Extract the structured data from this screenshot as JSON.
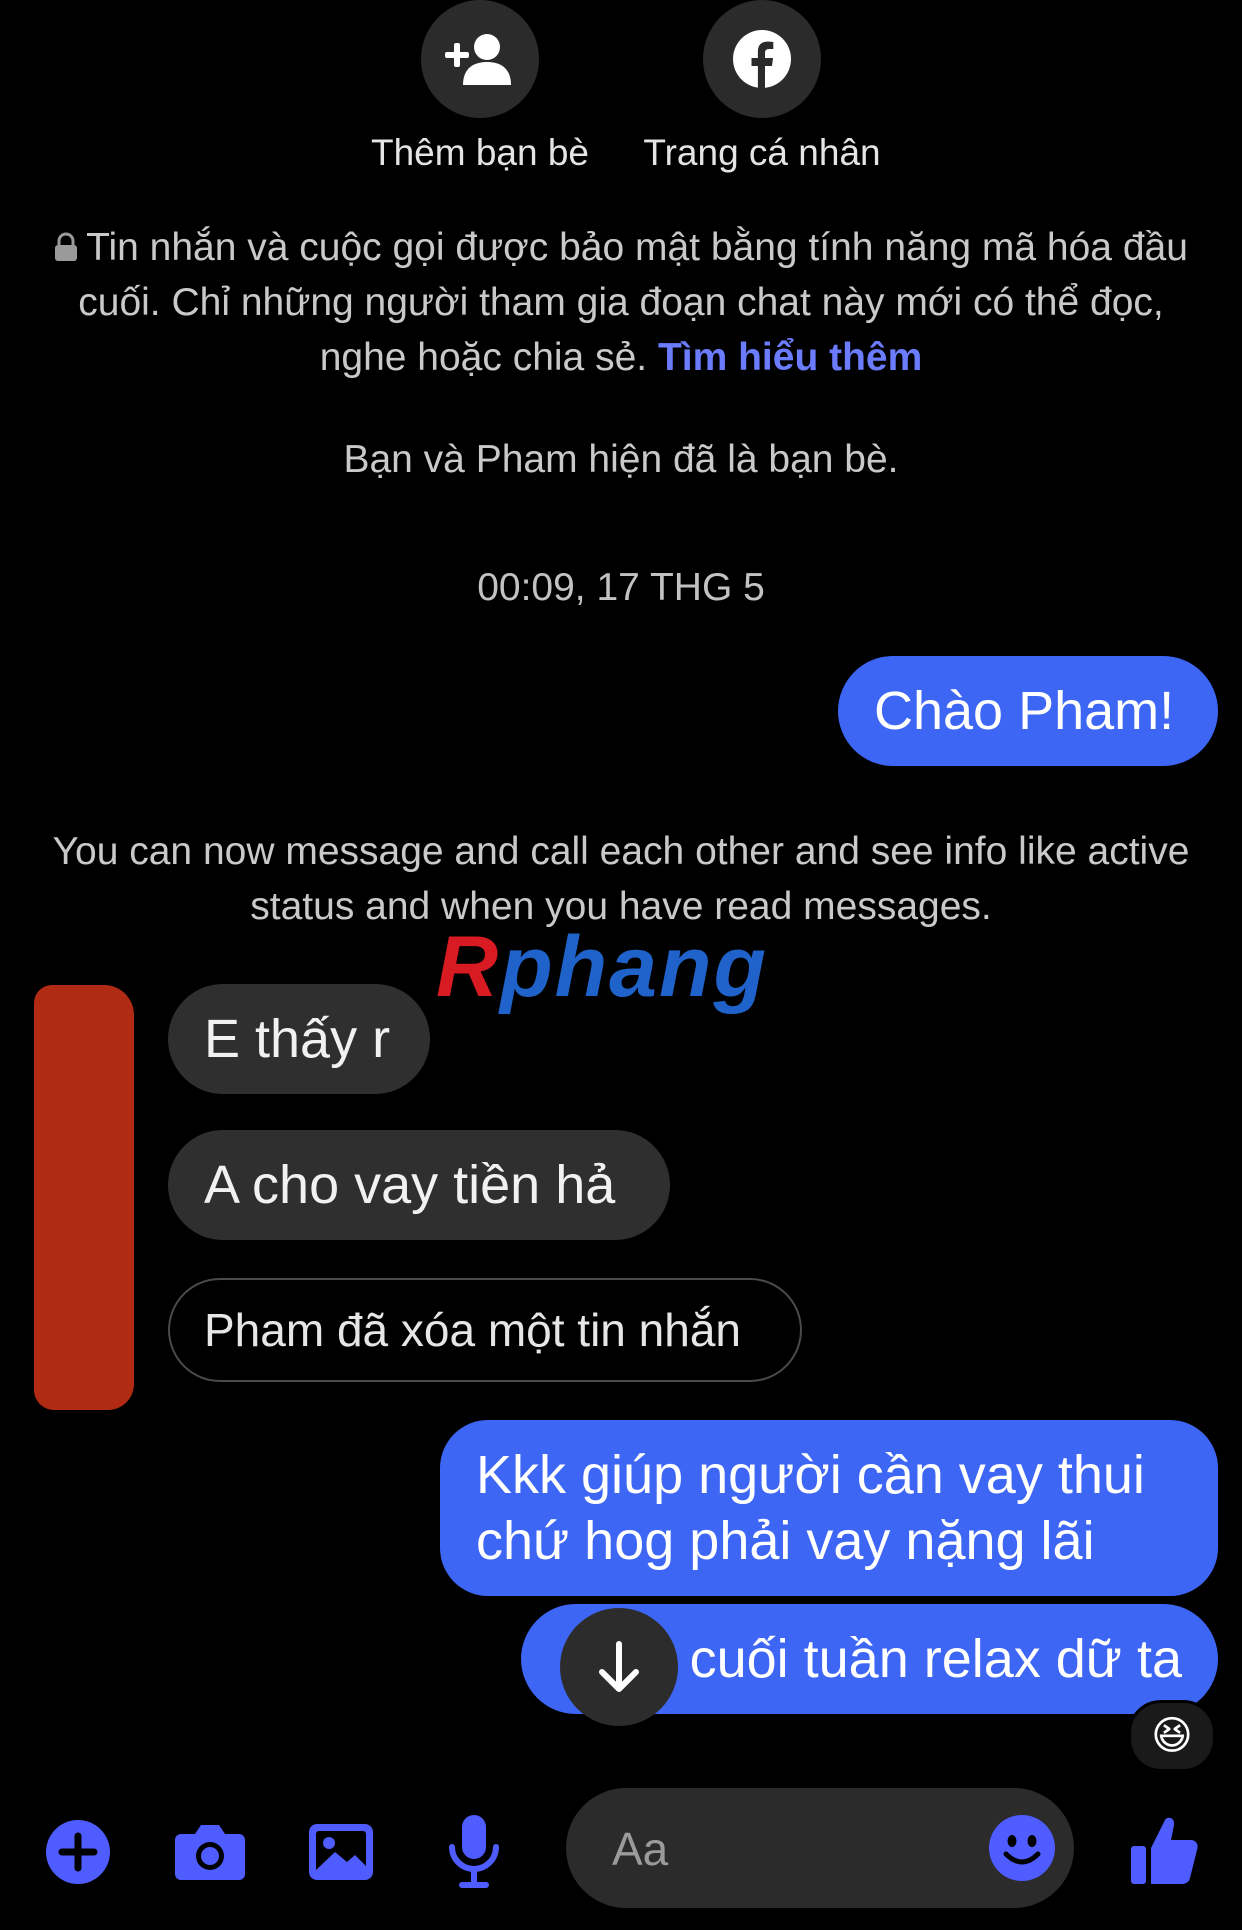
{
  "profile_actions": {
    "add_friend_label": "Thêm bạn bè",
    "profile_label": "Trang cá nhân"
  },
  "encryption_notice": {
    "text": "Tin nhắn và cuộc gọi được bảo mật bằng tính năng mã hóa đầu cuối. Chỉ những người tham gia đoạn chat này mới có thể đọc, nghe hoặc chia sẻ.",
    "link": "Tìm hiểu thêm"
  },
  "friend_status": "Bạn và Pham hiện đã là bạn bè.",
  "timestamp": "00:09, 17 THG 5",
  "messages": [
    {
      "direction": "outgoing",
      "text": "Chào Pham!"
    },
    {
      "direction": "incoming",
      "text": "E thấy r"
    },
    {
      "direction": "incoming",
      "text": "A cho vay tiền hả"
    },
    {
      "direction": "incoming",
      "text": "Pham đã xóa một tin nhắn",
      "deleted": true
    },
    {
      "direction": "outgoing",
      "text_line1": "Kkk giúp người cần vay thui",
      "text_line2": "chứ hog phải vay nặng lãi"
    },
    {
      "direction": "outgoing",
      "text": "cuối tuần relax dữ ta",
      "reaction": "😆"
    }
  ],
  "system_notice": "You can now message and call each other and see info like active status and when you have read messages.",
  "watermark": "Rphang",
  "composer": {
    "placeholder": "Aa"
  },
  "colors": {
    "accent": "#3d66f5",
    "icon_blue": "#4f5cff",
    "link": "#6b7cff"
  }
}
